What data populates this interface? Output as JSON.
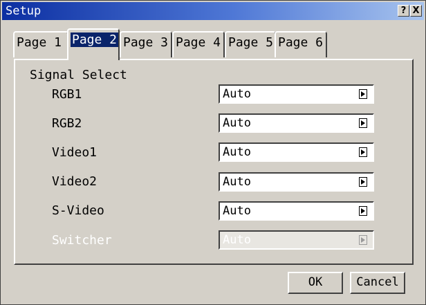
{
  "window": {
    "title": "Setup",
    "help_label": "?",
    "close_label": "X"
  },
  "tabs": [
    {
      "label": "Page 1"
    },
    {
      "label": "Page 2",
      "selected": true
    },
    {
      "label": "Page 3"
    },
    {
      "label": "Page 4"
    },
    {
      "label": "Page 5"
    },
    {
      "label": "Page 6"
    }
  ],
  "signal_select": {
    "group_label": "Signal Select",
    "rows": [
      {
        "label": "RGB1",
        "value": "Auto",
        "enabled": true
      },
      {
        "label": "RGB2",
        "value": "Auto",
        "enabled": true
      },
      {
        "label": "Video1",
        "value": "Auto",
        "enabled": true
      },
      {
        "label": "Video2",
        "value": "Auto",
        "enabled": true
      },
      {
        "label": "S-Video",
        "value": "Auto",
        "enabled": true
      },
      {
        "label": "Switcher",
        "value": "Auto",
        "enabled": false
      }
    ]
  },
  "buttons": {
    "ok": "OK",
    "cancel": "Cancel"
  },
  "colors": {
    "titlebar_start": "#0c2fa2",
    "titlebar_end": "#a8c4ee",
    "face": "#d4d0c8",
    "selected_tab_highlight": "#0a246a"
  }
}
